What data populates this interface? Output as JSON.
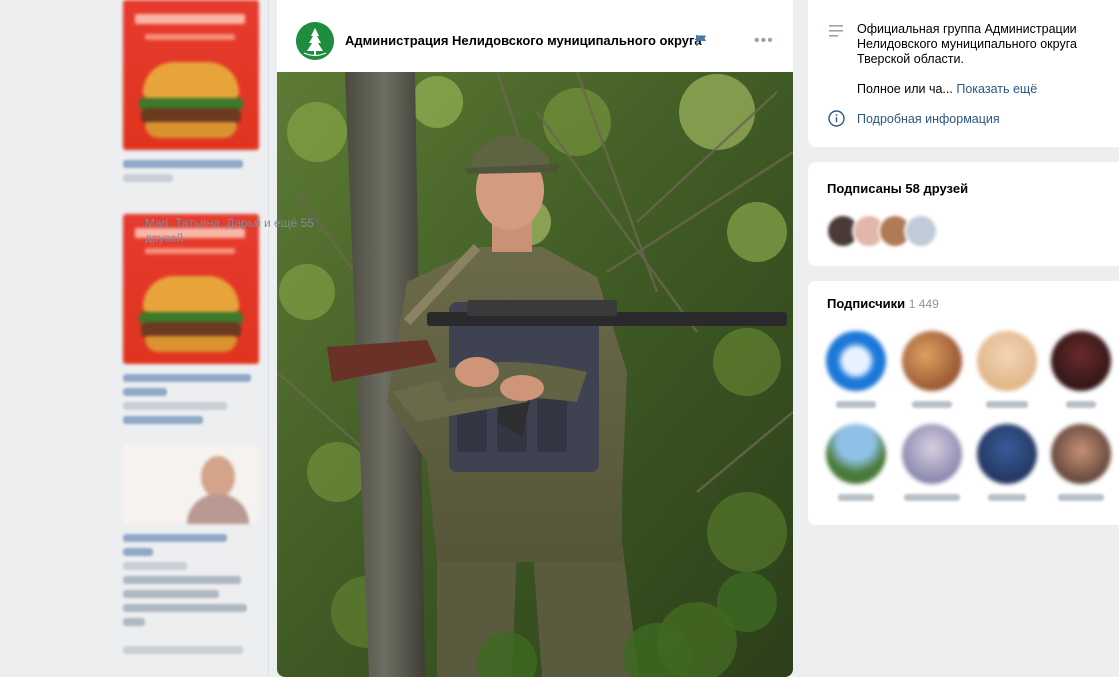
{
  "post": {
    "author": "Администрация Нелидовского муниципального округа",
    "menu_label": "•••"
  },
  "sidebar": {
    "about_text": "Официальная группа Администрации Нелидовского муниципального округа Тверской области.",
    "about_preview": "Полное или ча...",
    "show_more": "Показать ещё",
    "details_link": "Подробная информация",
    "friends_title": "Подписаны 58 друзей",
    "friends_text": "Mari, Татьяна, Дарья и ещё 55 друзей",
    "subscribers_title": "Подписчики",
    "subscribers_count": "1 449"
  },
  "icons": {
    "community_avatar": "tree-emblem-icon",
    "verified": "flag-icon",
    "more": "more-dots-icon",
    "description": "lines-icon",
    "info": "info-icon"
  },
  "colors": {
    "page_bg": "#edeef0",
    "link": "#2a5885",
    "ad_red": "#e63b2e",
    "avatar_green": "#1e8e3e"
  }
}
